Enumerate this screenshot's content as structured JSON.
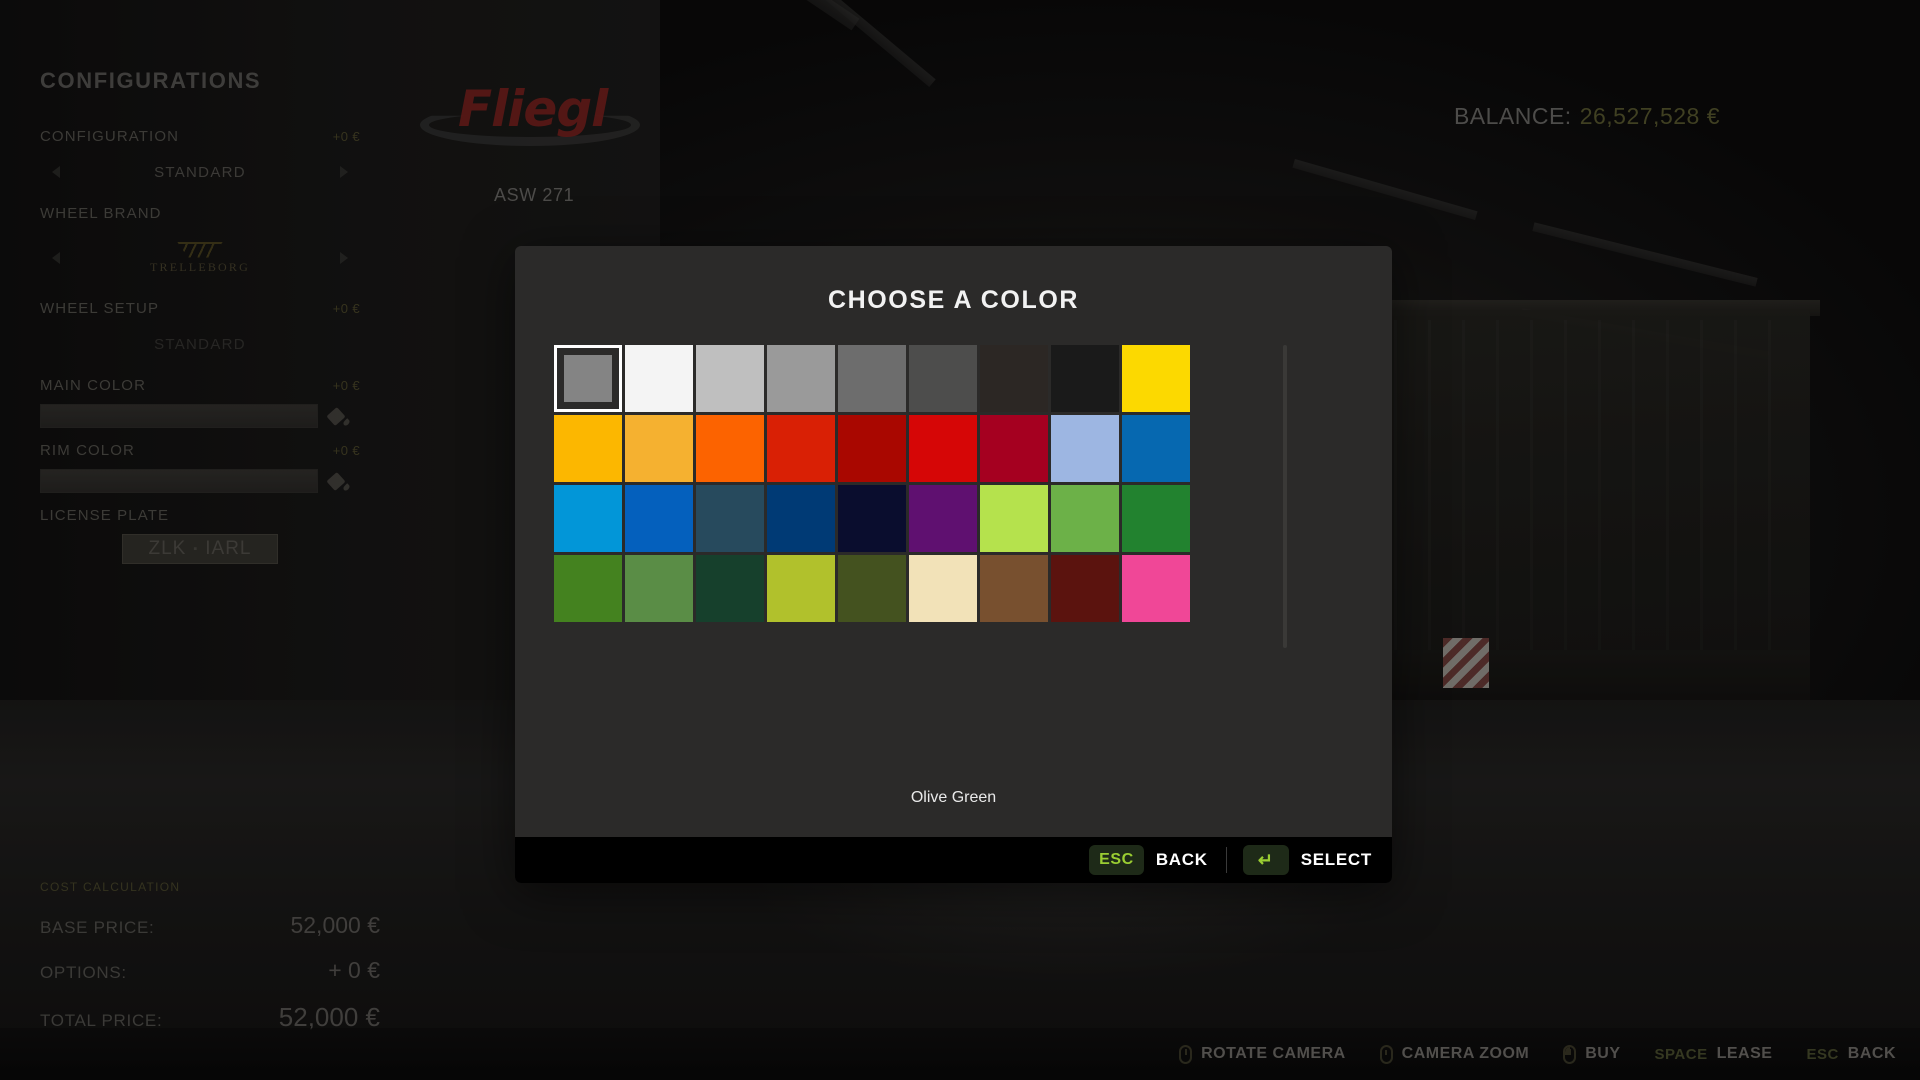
{
  "scene": {
    "brand_name": "Fliegl",
    "vehicle_name": "ASW 271",
    "balance_label": "BALANCE:",
    "balance_value": "26,527,528 €"
  },
  "sidebar": {
    "title": "CONFIGURATIONS",
    "groups": [
      {
        "label": "CONFIGURATION",
        "price": "+0 €",
        "value": "STANDARD",
        "type": "stepper"
      },
      {
        "label": "WHEEL BRAND",
        "price": "",
        "value": "TRELLEBORG",
        "type": "brand"
      },
      {
        "label": "WHEEL SETUP",
        "price": "+0 €",
        "value": "STANDARD",
        "type": "text"
      },
      {
        "label": "MAIN COLOR",
        "price": "+0 €",
        "value": "",
        "type": "color"
      },
      {
        "label": "RIM COLOR",
        "price": "+0 €",
        "value": "",
        "type": "color"
      },
      {
        "label": "LICENSE PLATE",
        "price": "",
        "value": "ZLK · IARL",
        "type": "plate"
      }
    ],
    "plate_text": "ZLK",
    "plate_text2": "IARL",
    "cost": {
      "title": "COST CALCULATION",
      "rows": [
        {
          "key": "BASE PRICE:",
          "value": "52,000 €"
        },
        {
          "key": "OPTIONS:",
          "value": "+ 0 €"
        },
        {
          "key": "TOTAL PRICE:",
          "value": "52,000 €"
        }
      ]
    }
  },
  "modal": {
    "title": "CHOOSE A COLOR",
    "selected_color_name": "Olive Green",
    "selected_index": 0,
    "footer": [
      {
        "key": "ESC",
        "label": "BACK",
        "icon": "esc-key"
      },
      {
        "key": "↵",
        "label": "SELECT",
        "icon": "enter-key"
      }
    ],
    "swatches": [
      {
        "name": "Grey",
        "hex": "#848484"
      },
      {
        "name": "White",
        "hex": "#f4f4f4"
      },
      {
        "name": "Light Grey",
        "hex": "#bfbfbf"
      },
      {
        "name": "Silver Grey",
        "hex": "#9a9a9a"
      },
      {
        "name": "Dark Grey",
        "hex": "#6d6d6d"
      },
      {
        "name": "Anthracite",
        "hex": "#4d4d4c"
      },
      {
        "name": "Dark Brown Grey",
        "hex": "#2c2724"
      },
      {
        "name": "Black",
        "hex": "#1a1a1a"
      },
      {
        "name": "Yellow",
        "hex": "#fcd900"
      },
      {
        "name": "Golden Yellow",
        "hex": "#fcb700"
      },
      {
        "name": "Amber",
        "hex": "#f5b130"
      },
      {
        "name": "Orange",
        "hex": "#fc6300"
      },
      {
        "name": "Bright Red",
        "hex": "#d92005"
      },
      {
        "name": "Dark Red",
        "hex": "#a90700"
      },
      {
        "name": "Red",
        "hex": "#d60606"
      },
      {
        "name": "Crimson",
        "hex": "#a50020"
      },
      {
        "name": "Pastel Blue",
        "hex": "#9db6e2"
      },
      {
        "name": "Blue",
        "hex": "#0668b0"
      },
      {
        "name": "Sky Blue",
        "hex": "#0296d8"
      },
      {
        "name": "Strong Blue",
        "hex": "#0460bd"
      },
      {
        "name": "Slate Blue",
        "hex": "#274a5d"
      },
      {
        "name": "Navy Blue",
        "hex": "#003a75"
      },
      {
        "name": "Midnight Blue",
        "hex": "#0a0d2e"
      },
      {
        "name": "Purple",
        "hex": "#5f1070"
      },
      {
        "name": "Lime Green",
        "hex": "#b5e24d"
      },
      {
        "name": "Light Green",
        "hex": "#6cb148"
      },
      {
        "name": "Forest Green",
        "hex": "#22822f"
      },
      {
        "name": "Grass Green",
        "hex": "#44821f"
      },
      {
        "name": "Medium Green",
        "hex": "#5a8d46"
      },
      {
        "name": "Dark Green",
        "hex": "#16402c"
      },
      {
        "name": "Yellow Green",
        "hex": "#b1c12c"
      },
      {
        "name": "Olive Green",
        "hex": "#44521f"
      },
      {
        "name": "Beige",
        "hex": "#f2e2b8"
      },
      {
        "name": "Brown",
        "hex": "#78502f"
      },
      {
        "name": "Dark Maroon",
        "hex": "#5b130e"
      },
      {
        "name": "Pink",
        "hex": "#f04797"
      }
    ]
  },
  "hintbar": {
    "items": [
      {
        "icon": "mouse-rotate-icon",
        "key": "",
        "label": "ROTATE CAMERA"
      },
      {
        "icon": "mouse-scroll-icon",
        "key": "",
        "label": "CAMERA ZOOM"
      },
      {
        "icon": "mouse-lmb-icon",
        "key": "",
        "label": "BUY"
      },
      {
        "icon": "",
        "key": "SPACE",
        "label": "LEASE"
      },
      {
        "icon": "",
        "key": "ESC",
        "label": "BACK"
      }
    ]
  }
}
